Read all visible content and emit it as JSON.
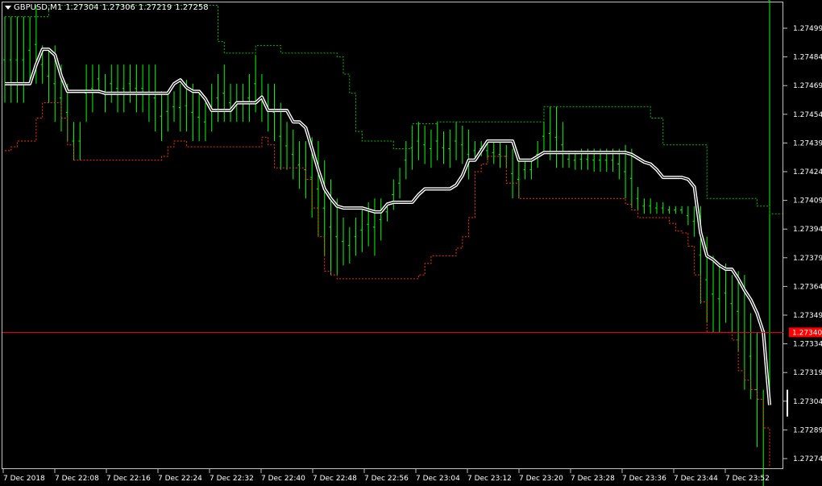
{
  "header": {
    "symbol": "GBPUSD,M1",
    "open": "1.27304",
    "high": "1.27306",
    "low": "1.27219",
    "close": "1.27258"
  },
  "colors": {
    "background": "#000000",
    "bars": "#00ff00",
    "upper_band": "#00c000",
    "lower_band": "#ff3300",
    "midline": "#ffffff",
    "price_line": "#ff0000",
    "axis": "#c0c0c0"
  },
  "chart_data": {
    "type": "bar",
    "title": "GBPUSD,M1",
    "y_ticks": [
      "1.27499",
      "1.27484",
      "1.27469",
      "1.27454",
      "1.27439",
      "1.27424",
      "1.27409",
      "1.27394",
      "1.27379",
      "1.27364",
      "1.27349",
      "1.27334",
      "1.27319",
      "1.27304",
      "1.27289",
      "1.27274"
    ],
    "x_ticks": [
      "7 Dec 2018",
      "7 Dec 22:08",
      "7 Dec 22:16",
      "7 Dec 22:24",
      "7 Dec 22:32",
      "7 Dec 22:40",
      "7 Dec 22:48",
      "7 Dec 22:56",
      "7 Dec 23:04",
      "7 Dec 23:12",
      "7 Dec 23:20",
      "7 Dec 23:28",
      "7 Dec 23:36",
      "7 Dec 23:44",
      "7 Dec 23:52"
    ],
    "current_price": "1.27340",
    "ylim": [
      1.2727,
      1.27512
    ],
    "midline": [
      1.2747,
      1.2747,
      1.2747,
      1.2747,
      1.2747,
      1.2748,
      1.27488,
      1.27488,
      1.27485,
      1.27474,
      1.27466,
      1.27466,
      1.27466,
      1.27466,
      1.27466,
      1.27466,
      1.27465,
      1.27465,
      1.27465,
      1.27465,
      1.27465,
      1.27465,
      1.27465,
      1.27465,
      1.27465,
      1.27465,
      1.27465,
      1.2747,
      1.27472,
      1.27468,
      1.27466,
      1.27466,
      1.27462,
      1.27456,
      1.27456,
      1.27456,
      1.27456,
      1.2746,
      1.2746,
      1.2746,
      1.2746,
      1.27463,
      1.27456,
      1.27456,
      1.27456,
      1.27456,
      1.2745,
      1.2745,
      1.27447,
      1.27436,
      1.27425,
      1.27415,
      1.2741,
      1.27406,
      1.27405,
      1.27405,
      1.27405,
      1.27405,
      1.27404,
      1.27403,
      1.27403,
      1.27407,
      1.27408,
      1.27408,
      1.27408,
      1.27408,
      1.27412,
      1.27415,
      1.27415,
      1.27415,
      1.27415,
      1.27415,
      1.27417,
      1.27422,
      1.2743,
      1.2743,
      1.27435,
      1.2744,
      1.2744,
      1.2744,
      1.2744,
      1.2744,
      1.2743,
      1.2743,
      1.2743,
      1.27432,
      1.27434,
      1.27434,
      1.27434,
      1.27434,
      1.27434,
      1.27434,
      1.27434,
      1.27434,
      1.27434,
      1.27434,
      1.27434,
      1.27434,
      1.27434,
      1.27434,
      1.27433,
      1.27431,
      1.27429,
      1.27428,
      1.27425,
      1.27421,
      1.27421,
      1.27421,
      1.27421,
      1.2742,
      1.27416,
      1.27392,
      1.2738,
      1.27378,
      1.27375,
      1.27373,
      1.27373,
      1.27368,
      1.27362,
      1.27357,
      1.2735,
      1.2734,
      1.27302
    ],
    "upper_band": [
      1.27505,
      1.27505,
      1.27505,
      1.27505,
      1.27505,
      1.27505,
      1.27505,
      1.27511,
      1.27511,
      1.27511,
      1.27511,
      1.27511,
      1.27511,
      1.27511,
      1.27511,
      1.27511,
      1.27511,
      1.27511,
      1.27511,
      1.27511,
      1.27511,
      1.27511,
      1.27511,
      1.27511,
      1.27511,
      1.27511,
      1.27511,
      1.27511,
      1.27511,
      1.27511,
      1.27511,
      1.27511,
      1.27511,
      1.27511,
      1.27492,
      1.27486,
      1.27486,
      1.27486,
      1.27486,
      1.27486,
      1.2749,
      1.2749,
      1.2749,
      1.2749,
      1.27486,
      1.27486,
      1.27486,
      1.27486,
      1.27486,
      1.27486,
      1.27486,
      1.27486,
      1.27486,
      1.27484,
      1.27475,
      1.27465,
      1.27445,
      1.2744,
      1.2744,
      1.2744,
      1.2744,
      1.2744,
      1.27436,
      1.27436,
      1.27436,
      1.27449,
      1.27449,
      1.27449,
      1.27449,
      1.2745,
      1.2745,
      1.2745,
      1.2745,
      1.2745,
      1.2745,
      1.2745,
      1.2745,
      1.2745,
      1.2745,
      1.2745,
      1.2745,
      1.2745,
      1.2745,
      1.2745,
      1.2745,
      1.2745,
      1.27458,
      1.27458,
      1.27458,
      1.27458,
      1.27458,
      1.27458,
      1.27458,
      1.27458,
      1.27458,
      1.27458,
      1.27458,
      1.27458,
      1.27458,
      1.27458,
      1.27458,
      1.27458,
      1.27458,
      1.27452,
      1.27452,
      1.27438,
      1.27438,
      1.27438,
      1.27438,
      1.27438,
      1.27438,
      1.27438,
      1.2741,
      1.2741,
      1.2741,
      1.2741,
      1.2741,
      1.2741,
      1.2741,
      1.2741,
      1.27406,
      1.27406,
      1.27402,
      1.27402,
      1.27402
    ],
    "lower_band": [
      1.27435,
      1.27437,
      1.2744,
      1.2744,
      1.2744,
      1.27452,
      1.2746,
      1.2746,
      1.2746,
      1.27452,
      1.27438,
      1.2743,
      1.2743,
      1.2743,
      1.2743,
      1.2743,
      1.2743,
      1.2743,
      1.2743,
      1.2743,
      1.2743,
      1.2743,
      1.2743,
      1.2743,
      1.2743,
      1.27432,
      1.27437,
      1.2744,
      1.2744,
      1.27437,
      1.27437,
      1.27437,
      1.27437,
      1.27437,
      1.27437,
      1.27437,
      1.27437,
      1.27437,
      1.27437,
      1.27437,
      1.27437,
      1.27442,
      1.27438,
      1.27426,
      1.27426,
      1.27426,
      1.27426,
      1.27426,
      1.2742,
      1.27405,
      1.2739,
      1.27372,
      1.2737,
      1.27368,
      1.27368,
      1.27368,
      1.27368,
      1.27368,
      1.27368,
      1.27368,
      1.27368,
      1.27368,
      1.27368,
      1.27368,
      1.27368,
      1.27368,
      1.2737,
      1.27376,
      1.2738,
      1.2738,
      1.2738,
      1.2738,
      1.27384,
      1.2739,
      1.274,
      1.27424,
      1.27428,
      1.27432,
      1.27432,
      1.27432,
      1.27418,
      1.27418,
      1.2741,
      1.2741,
      1.2741,
      1.2741,
      1.2741,
      1.2741,
      1.2741,
      1.2741,
      1.2741,
      1.2741,
      1.2741,
      1.2741,
      1.2741,
      1.2741,
      1.2741,
      1.2741,
      1.2741,
      1.27407,
      1.27404,
      1.274,
      1.274,
      1.274,
      1.274,
      1.274,
      1.27397,
      1.27393,
      1.27392,
      1.27385,
      1.2737,
      1.27356,
      1.2734,
      1.2734,
      1.2734,
      1.2734,
      1.27336,
      1.2732,
      1.27315,
      1.2731,
      1.27305,
      1.2729,
      1.2727
    ],
    "bars_high": [
      1.27505,
      1.27505,
      1.27505,
      1.27505,
      1.27505,
      1.27511,
      1.2749,
      1.27488,
      1.2749,
      1.2748,
      1.2747,
      1.2745,
      1.2745,
      1.2748,
      1.2748,
      1.2748,
      1.27475,
      1.2748,
      1.2748,
      1.2748,
      1.2748,
      1.2748,
      1.2748,
      1.2748,
      1.2748,
      1.27466,
      1.27466,
      1.27466,
      1.2747,
      1.27472,
      1.2747,
      1.27465,
      1.2746,
      1.2747,
      1.27475,
      1.2748,
      1.2747,
      1.2747,
      1.2747,
      1.27475,
      1.27485,
      1.27475,
      1.2747,
      1.2747,
      1.2746,
      1.2745,
      1.27446,
      1.2744,
      1.2744,
      1.27442,
      1.2744,
      1.2743,
      1.2742,
      1.2741,
      1.274,
      1.27395,
      1.274,
      1.27405,
      1.27408,
      1.2741,
      1.2741,
      1.27408,
      1.2742,
      1.27426,
      1.2744,
      1.27448,
      1.2745,
      1.27448,
      1.27446,
      1.2745,
      1.27445,
      1.27446,
      1.2745,
      1.27448,
      1.27446,
      1.2744,
      1.2744,
      1.2744,
      1.2744,
      1.2744,
      1.27438,
      1.27436,
      1.2743,
      1.2743,
      1.2743,
      1.2744,
      1.2745,
      1.27458,
      1.27458,
      1.2745,
      1.27435,
      1.27435,
      1.27436,
      1.27436,
      1.27436,
      1.27436,
      1.27436,
      1.27436,
      1.27436,
      1.27438,
      1.27436,
      1.27416,
      1.2741,
      1.2741,
      1.27408,
      1.27408,
      1.27406,
      1.27406,
      1.27406,
      1.27406,
      1.27406,
      1.27406,
      1.2739,
      1.2738,
      1.27375,
      1.27376,
      1.2737,
      1.27372,
      1.2737,
      1.2735,
      1.2734,
      1.2731,
      1.27306
    ],
    "bars_low": [
      1.2746,
      1.2746,
      1.2746,
      1.2746,
      1.2747,
      1.2747,
      1.2747,
      1.2746,
      1.2745,
      1.27445,
      1.2744,
      1.2743,
      1.2743,
      1.2745,
      1.27455,
      1.27465,
      1.27455,
      1.2746,
      1.27455,
      1.27455,
      1.2746,
      1.27455,
      1.27455,
      1.2745,
      1.27445,
      1.2744,
      1.27445,
      1.2745,
      1.27445,
      1.27445,
      1.2744,
      1.2744,
      1.2744,
      1.27445,
      1.2745,
      1.2745,
      1.2745,
      1.2745,
      1.2745,
      1.2745,
      1.27455,
      1.2745,
      1.27445,
      1.2744,
      1.27425,
      1.27425,
      1.2742,
      1.27415,
      1.2741,
      1.274,
      1.2739,
      1.2738,
      1.2737,
      1.2737,
      1.27375,
      1.27376,
      1.2738,
      1.27382,
      1.27385,
      1.2738,
      1.27388,
      1.27398,
      1.27404,
      1.2741,
      1.2742,
      1.27425,
      1.2743,
      1.27428,
      1.27426,
      1.2743,
      1.27428,
      1.27426,
      1.2743,
      1.27428,
      1.2742,
      1.2743,
      1.27432,
      1.2743,
      1.27428,
      1.27426,
      1.27426,
      1.2741,
      1.2741,
      1.2742,
      1.2742,
      1.27426,
      1.27435,
      1.2743,
      1.27426,
      1.27426,
      1.27426,
      1.27425,
      1.27425,
      1.27425,
      1.27424,
      1.27424,
      1.27424,
      1.27424,
      1.2742,
      1.2741,
      1.27405,
      1.27404,
      1.27402,
      1.27402,
      1.27402,
      1.27402,
      1.27402,
      1.27402,
      1.27402,
      1.27396,
      1.2739,
      1.27355,
      1.27345,
      1.2734,
      1.2734,
      1.27345,
      1.2734,
      1.2733,
      1.2731,
      1.27305,
      1.2728,
      1.27219
    ]
  }
}
